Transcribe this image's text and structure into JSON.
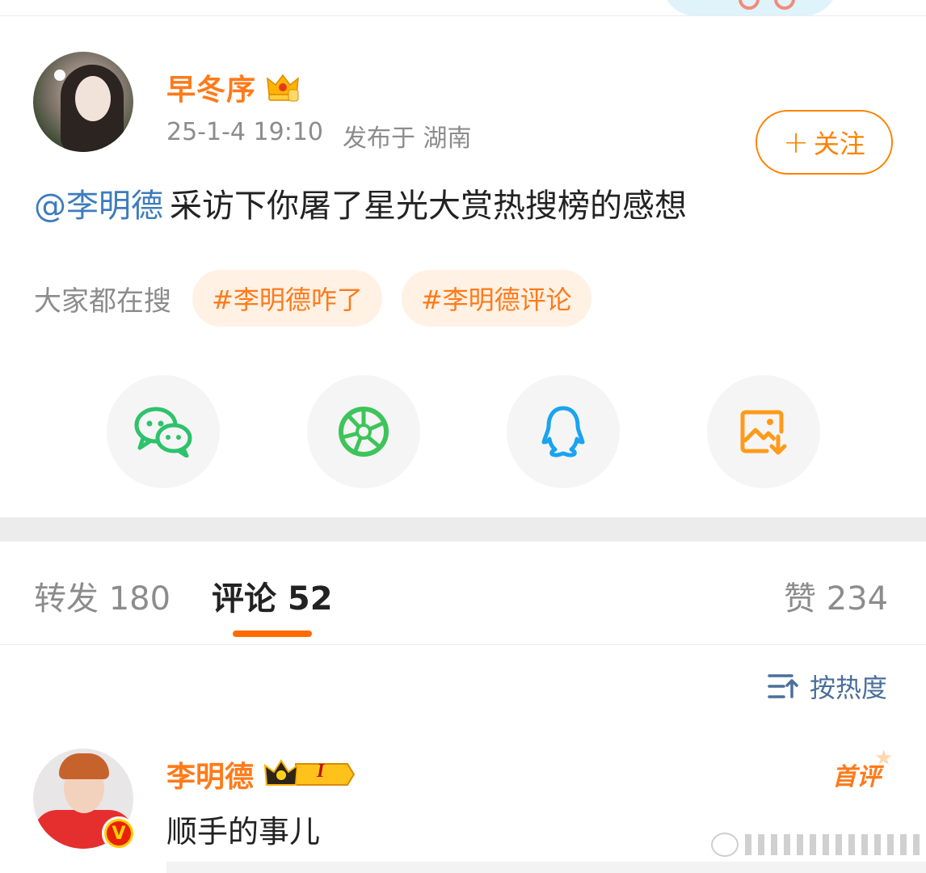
{
  "post": {
    "username": "早冬序",
    "date": "25-1-4 19:10",
    "location_text": "发布于 湖南",
    "follow_label": "关注",
    "follow_plus": "+",
    "mention": "@李明德",
    "text": "采访下你屠了星光大赏热搜榜的感想"
  },
  "search": {
    "label": "大家都在搜",
    "tags": [
      "#李明德咋了",
      "#李明德评论"
    ]
  },
  "share": {
    "items": [
      {
        "icon": "wechat-icon",
        "color": "#2dc26b"
      },
      {
        "icon": "moments-icon",
        "color": "#3ec45a"
      },
      {
        "icon": "qq-icon",
        "color": "#1aa3f0"
      },
      {
        "icon": "save-image-icon",
        "color": "#ff9a1a"
      }
    ]
  },
  "tabs": {
    "repost": "转发 180",
    "comment": "评论 52",
    "like": "赞 234"
  },
  "sort": {
    "label": "按热度"
  },
  "comment": {
    "username": "李明德",
    "level_badge": "I",
    "first_comment_badge": "首评",
    "text": "顺手的事儿"
  },
  "colors": {
    "accent": "#ff7a1a",
    "link": "#3d7cbd",
    "muted": "#8c8c8c"
  }
}
